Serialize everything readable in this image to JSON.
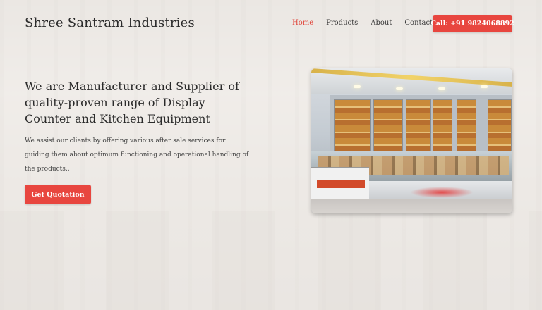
{
  "header": {
    "brand": "Shree Santram Industries",
    "nav": {
      "home": "Home",
      "products": "Products",
      "about": "About",
      "contact": "Contact"
    },
    "call_button": "Call: +91 9824068892"
  },
  "hero": {
    "title": "We are Manufacturer and Supplier of quality-proven range of Display Counter and Kitchen Equipment",
    "description": "We assist our clients by offering various after sale services for guiding them about optimum functioning and operational handling of the products..",
    "quote_button": "Get Quotation"
  },
  "colors": {
    "accent": "#e8463f",
    "nav_active": "#e0473c"
  }
}
